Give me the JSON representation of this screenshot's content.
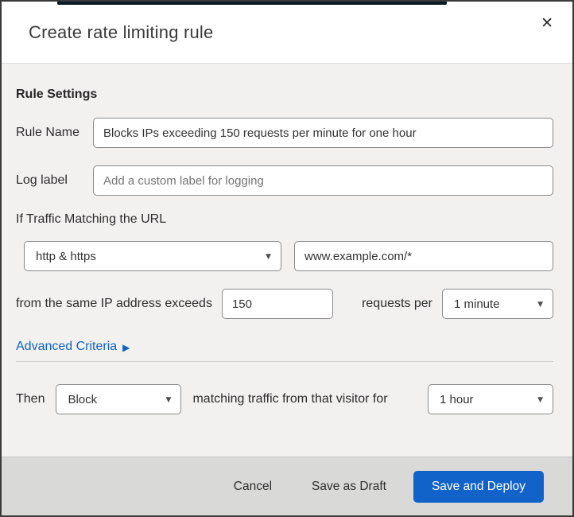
{
  "header": {
    "title": "Create rate limiting rule"
  },
  "icons": {
    "close": "✕",
    "dropdown_caret": "▼",
    "advanced_arrow": "▶"
  },
  "rule_settings": {
    "heading": "Rule Settings",
    "rule_name_label": "Rule Name",
    "rule_name_value": "Blocks IPs exceeding 150 requests per minute for one hour",
    "log_label_label": "Log label",
    "log_label_placeholder": "Add a custom label for logging"
  },
  "criteria": {
    "intro": "If Traffic Matching the URL",
    "scheme_selected": "http & https",
    "url_value": "www.example.com/*",
    "threshold_prefix": "from the same IP address exceeds",
    "threshold_value": "150",
    "threshold_suffix": "requests per",
    "period_selected": "1 minute",
    "advanced_link": "Advanced Criteria"
  },
  "action": {
    "prefix": "Then",
    "action_selected": "Block",
    "middle": "matching traffic from that visitor for",
    "duration_selected": "1 hour"
  },
  "footer": {
    "cancel": "Cancel",
    "save_draft": "Save as Draft",
    "save_deploy": "Save and Deploy"
  },
  "colors": {
    "primary_button": "#1163c9",
    "link": "#0e63c5",
    "top_accent_bar": "#0c1b29",
    "body_bg": "#f2f1f0",
    "footer_bg": "#d9d9d8"
  }
}
